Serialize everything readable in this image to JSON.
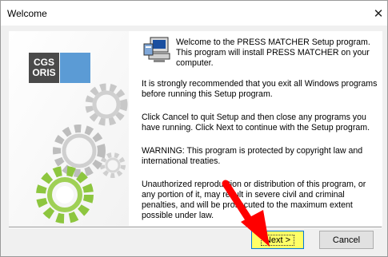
{
  "window": {
    "title": "Welcome",
    "close_glyph": "✕"
  },
  "art_panel": {
    "logo_line1": "CGS",
    "logo_line2": "ORIS"
  },
  "content": {
    "welcome_line": "Welcome to the PRESS MATCHER Setup program. This program will install PRESS MATCHER on your computer.",
    "para1": "It is strongly recommended that you exit all Windows programs before running this Setup program.",
    "para2": "Click Cancel to quit Setup and then close any programs you have running.  Click Next to continue with the Setup program.",
    "para3": "WARNING: This program is protected by copyright law and international treaties.",
    "para4": "Unauthorized reproduction or distribution of this program, or any portion of it, may result in severe civil and criminal penalties, and will be prosecuted to the maximum extent possible under law."
  },
  "buttons": {
    "next_label": "Next >",
    "cancel_label": "Cancel"
  },
  "colors": {
    "logo_blue": "#5b9bd5",
    "gear_green": "#8dc63f",
    "gear_gray": "#c8c8c8",
    "highlight_yellow": "#ffff66",
    "arrow_red": "#ff0000"
  },
  "icons": {
    "setup": "setup-computer-icon",
    "close": "close-icon",
    "annotation": "red-arrow"
  }
}
